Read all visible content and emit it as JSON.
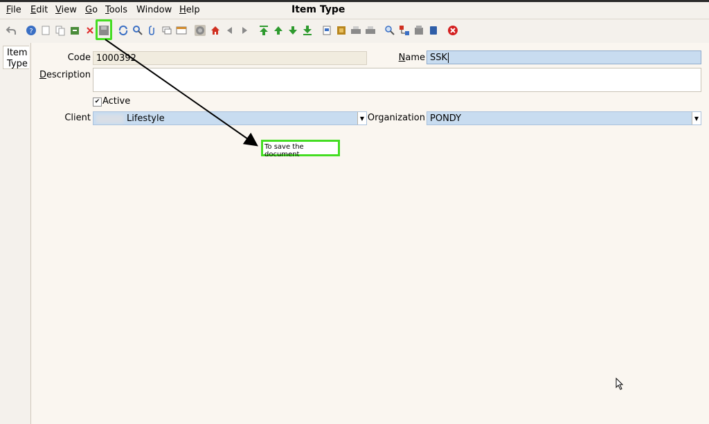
{
  "window": {
    "title": "Item Type"
  },
  "menu": [
    {
      "label": "File",
      "key": "F",
      "rest": "ile"
    },
    {
      "label": "Edit",
      "key": "E",
      "rest": "dit"
    },
    {
      "label": "View",
      "key": "V",
      "rest": "iew"
    },
    {
      "label": "Go",
      "key": "G",
      "rest": "o"
    },
    {
      "label": "Tools",
      "key": "T",
      "rest": "ools"
    },
    {
      "label": "Window",
      "key": "",
      "rest": "Window"
    },
    {
      "label": "Help",
      "key": "H",
      "rest": "elp"
    }
  ],
  "toolbar": {
    "icons": [
      "undo-icon",
      "help-icon",
      "new-record-icon",
      "copy-record-icon",
      "archive-icon",
      "delete-icon",
      "save-icon",
      "refresh-icon",
      "find-icon",
      "attachment-icon",
      "chat-icon",
      "grid-toggle-icon",
      "history-icon",
      "home-icon",
      "back-icon",
      "forward-icon",
      "first-record-icon",
      "previous-record-icon",
      "next-record-icon",
      "last-record-icon",
      "report-icon",
      "archive-view-icon",
      "print-icon",
      "print-preview-icon",
      "zoom-icon",
      "workflow-icon",
      "product-info-icon",
      "lock-icon",
      "close-window-icon"
    ]
  },
  "tabs": [
    {
      "label_line1": "Item",
      "label_line2": "Type"
    }
  ],
  "form": {
    "code_label": "Code",
    "code_value": "1000392",
    "name_label_key": "N",
    "name_label_rest": "ame",
    "name_value": "SSK",
    "description_label_key": "D",
    "description_label_rest": "escription",
    "description_value": "",
    "active_label": "Active",
    "active_checked": "✔",
    "client_label": "Client",
    "client_value": "Lifestyle",
    "organization_label": "Organization",
    "organization_value": "PONDY"
  },
  "annotation": {
    "tooltip_text": "To save the document"
  },
  "colors": {
    "highlight": "#44dd22",
    "editable_bg": "#c8dcf0",
    "readonly_bg": "#f1ecdf"
  }
}
